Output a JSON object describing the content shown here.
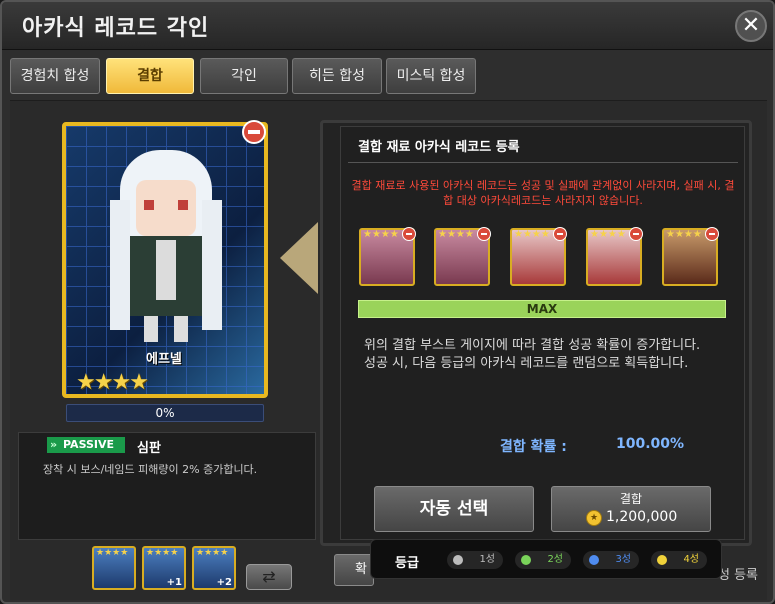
{
  "window": {
    "title": "아카식 레코드 각인",
    "close": "✕"
  },
  "tabs": [
    {
      "label": "경험치 합성"
    },
    {
      "label": "결합"
    },
    {
      "label": "각인"
    },
    {
      "label": "히든 합성"
    },
    {
      "label": "미스틱 합성"
    }
  ],
  "active_tab": "결합",
  "card": {
    "name": "에프넬",
    "stars": "★★★★",
    "progress": "0%"
  },
  "skill": {
    "badge": "PASSIVE",
    "name": "심판",
    "desc": "장착 시 보스/네임드 피해량이 2% 증가합니다."
  },
  "thumbs": [
    {
      "stars": "★★★★",
      "level": ""
    },
    {
      "stars": "★★★★",
      "level": "+1"
    },
    {
      "stars": "★★★★",
      "level": "+2"
    }
  ],
  "register": {
    "title": "결합 재료 아카식 레코드 등록",
    "warning": "결합 재료로 사용된 아카식 레코드는 성공 및 실패에 관계없이 사라지며, 실패 시, 결합 대상 아카식레코드는 사라지지 않습니다.",
    "materials": [
      {
        "stars": "★★★★"
      },
      {
        "stars": "★★★★"
      },
      {
        "stars": "★★★★"
      },
      {
        "stars": "★★★★"
      },
      {
        "stars": "★★★★"
      }
    ],
    "max_label": "MAX",
    "info_line1": "위의 결합 부스트 게이지에 따라 결합 성공 확률이 증가합니다.",
    "info_line2": "성공 시, 다음 등급의 아카식 레코드를 랜덤으로 획득합니다.",
    "rate_label": "결합 확률 :",
    "rate_value": "100.00%",
    "auto_button": "자동 선택",
    "combine_label": "결합",
    "combine_cost": "1,200,000"
  },
  "bottom": {
    "left_btn": "확",
    "right_text": "성 등록"
  },
  "grade": {
    "label": "등급",
    "items": [
      {
        "label": "1성",
        "color": "#bdbdbd"
      },
      {
        "label": "2성",
        "color": "#7ad35a"
      },
      {
        "label": "3성",
        "color": "#4f8cf0"
      },
      {
        "label": "4성",
        "color": "#f0d23a"
      }
    ]
  }
}
